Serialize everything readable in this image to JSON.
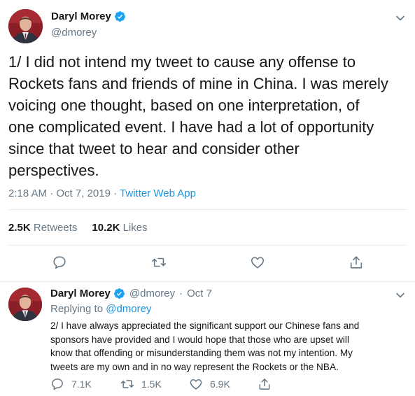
{
  "main": {
    "author_name": "Daryl Morey",
    "handle": "@dmorey",
    "text": "1/ I did not intend my tweet to cause any offense to\nRockets fans and friends of mine in China. I was merely\nvoicing one thought, based on one interpretation, of\none complicated event. I have had a lot of opportunity\nsince that tweet to hear and consider other\nperspectives.",
    "time": "2:18 AM",
    "date": "Oct 7, 2019",
    "separator": "·",
    "source": "Twitter Web App",
    "retweets_count": "2.5K",
    "retweets_label": "Retweets",
    "likes_count": "10.2K",
    "likes_label": "Likes"
  },
  "reply": {
    "author_name": "Daryl Morey",
    "handle": "@dmorey",
    "date": "Oct 7",
    "separator": "·",
    "replying_label": "Replying to",
    "replying_handle": "@dmorey",
    "text": "2/ I have always appreciated the significant support our Chinese fans and\nsponsors have provided and I would hope that those who are upset will\nknow that offending or misunderstanding them was not my intention. My\ntweets are my own and in no way represent the Rockets or the NBA.",
    "replies_count": "7.1K",
    "retweets_count": "1.5K",
    "likes_count": "6.9K"
  },
  "icons": {
    "verified": "verified-badge-icon",
    "caret": "chevron-down-icon",
    "reply": "speech-bubble-icon",
    "retweet": "retweet-arrows-icon",
    "like": "heart-icon",
    "share": "share-upload-icon"
  },
  "colors": {
    "text": "#14171a",
    "secondary": "#657786",
    "link": "#1b95e0",
    "verified": "#1da1f2",
    "divider": "#e6ecf0"
  }
}
